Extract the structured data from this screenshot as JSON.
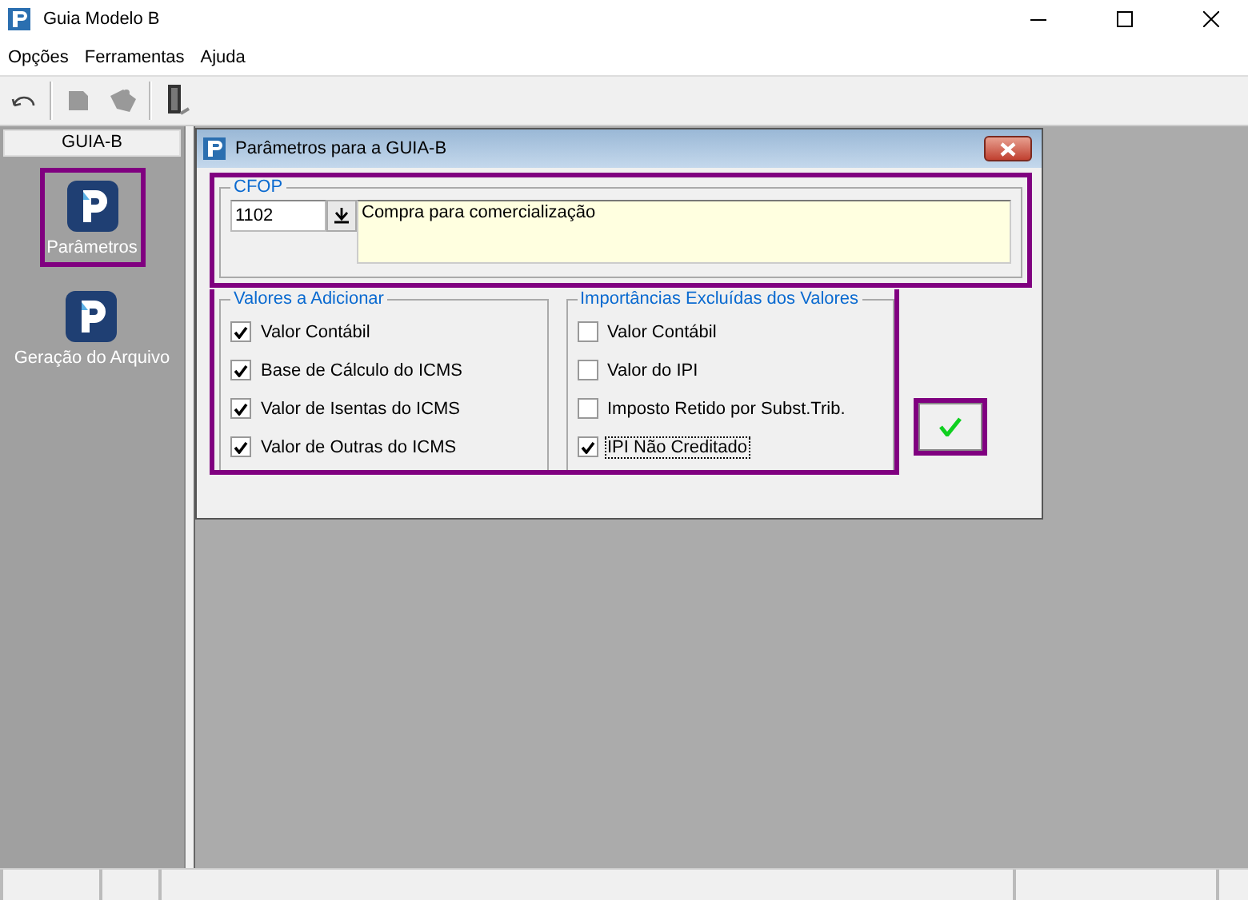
{
  "window": {
    "title": "Guia Modelo B"
  },
  "menu": [
    "Opções",
    "Ferramentas",
    "Ajuda"
  ],
  "toolbar": [
    {
      "kind": "undo",
      "disabled": false
    },
    {
      "kind": "box",
      "disabled": true
    },
    {
      "kind": "puzzle",
      "disabled": true
    },
    {
      "kind": "exit",
      "disabled": false
    }
  ],
  "sidebar": {
    "title": "GUIA-B",
    "items": [
      {
        "label": "Parâmetros",
        "selected": true
      },
      {
        "label": "Geração do Arquivo",
        "selected": false
      }
    ]
  },
  "dialog": {
    "title": "Parâmetros para a GUIA-B",
    "cfop": {
      "title": "CFOP",
      "code": "1102",
      "description": "Compra para comercialização",
      "highlighted": true
    },
    "groups_highlighted": true,
    "groups": [
      {
        "title": "Valores a Adicionar",
        "items": [
          {
            "label": "Valor Contábil",
            "checked": true,
            "focused": false
          },
          {
            "label": "Base de Cálculo do ICMS",
            "checked": true,
            "focused": false
          },
          {
            "label": "Valor de Isentas do ICMS",
            "checked": true,
            "focused": false
          },
          {
            "label": "Valor de Outras do ICMS",
            "checked": true,
            "focused": false
          }
        ]
      },
      {
        "title": "Importâncias Excluídas dos Valores",
        "items": [
          {
            "label": "Valor Contábil",
            "checked": false,
            "focused": false
          },
          {
            "label": "Valor do IPI",
            "checked": false,
            "focused": false
          },
          {
            "label": "Imposto Retido por Subst.Trib.",
            "checked": false,
            "focused": false
          },
          {
            "label": "IPI Não Creditado",
            "checked": true,
            "focused": true
          }
        ]
      }
    ],
    "ok_highlighted": true
  }
}
